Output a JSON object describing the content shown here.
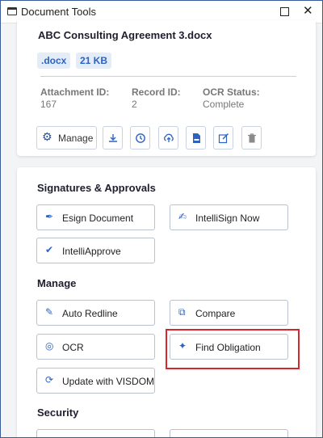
{
  "window": {
    "title": "Document Tools"
  },
  "file": {
    "name": "ABC Consulting Agreement 3.docx",
    "extension": ".docx",
    "size": "21 KB"
  },
  "meta": {
    "attachment_id_label": "Attachment ID:",
    "attachment_id_value": "167",
    "record_id_label": "Record ID:",
    "record_id_value": "2",
    "ocr_status_label": "OCR Status:",
    "ocr_status_value": "Complete"
  },
  "toolbar": {
    "manage_label": "Manage",
    "icons": [
      "download-icon",
      "history-icon",
      "upload-icon",
      "doc-icon",
      "edit-icon",
      "trash-icon"
    ]
  },
  "sections": {
    "signatures": {
      "title": "Signatures & Approvals",
      "esign": "Esign Document",
      "intellisign": "IntelliSign Now",
      "intelliapprove": "IntelliApprove"
    },
    "manage": {
      "title": "Manage",
      "auto_redline": "Auto Redline",
      "compare": "Compare",
      "ocr": "OCR",
      "find_obligation": "Find Obligation",
      "update_visdom": "Update with VISDOM"
    },
    "security": {
      "title": "Security"
    }
  },
  "colors": {
    "accent": "#2b63c4",
    "highlight": "#d9252c",
    "window_border": "#3a5b9a"
  }
}
